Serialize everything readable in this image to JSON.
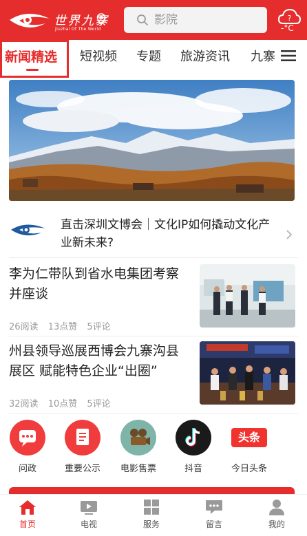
{
  "header": {
    "logo_text": "世界九寨",
    "logo_sub": "Jiuzhai Of The World",
    "search_placeholder": "影院",
    "weather_temp": "-°C"
  },
  "tabs": [
    {
      "label": "新闻精选",
      "active": true
    },
    {
      "label": "短视频",
      "active": false
    },
    {
      "label": "专题",
      "active": false
    },
    {
      "label": "旅游资讯",
      "active": false
    },
    {
      "label": "九寨",
      "active": false
    }
  ],
  "headline": {
    "title": "直击深圳文博会｜文化IP如何撬动文化产业新未来?"
  },
  "news": [
    {
      "title": "李为仁带队到省水电集团考察并座谈",
      "reads": "26阅读",
      "likes": "13点赞",
      "comments": "5评论"
    },
    {
      "title": "州县领导巡展西博会九寨沟县展区 赋能特色企业“出圈”",
      "reads": "32阅读",
      "likes": "10点赞",
      "comments": "5评论"
    }
  ],
  "services": [
    {
      "label": "问政",
      "icon": "chat-icon",
      "color": "#f03c3c"
    },
    {
      "label": "重要公示",
      "icon": "document-icon",
      "color": "#f03c3c"
    },
    {
      "label": "电影售票",
      "icon": "film-camera-icon",
      "color": "#7fb5a8"
    },
    {
      "label": "抖音",
      "icon": "tiktok-icon",
      "color": "#1a1a1a"
    },
    {
      "label": "今日头条",
      "icon": "toutiao-icon",
      "color": "#ffffff"
    }
  ],
  "services_toutiao_badge": "头条",
  "bottom_nav": [
    {
      "label": "首页",
      "icon": "home-icon",
      "active": true
    },
    {
      "label": "电视",
      "icon": "tv-icon",
      "active": false
    },
    {
      "label": "服务",
      "icon": "grid-icon",
      "active": false
    },
    {
      "label": "留言",
      "icon": "message-icon",
      "active": false
    },
    {
      "label": "我的",
      "icon": "user-icon",
      "active": false
    }
  ],
  "colors": {
    "brand_red": "#e52d2d",
    "text_dark": "#222222",
    "meta_gray": "#999999"
  }
}
